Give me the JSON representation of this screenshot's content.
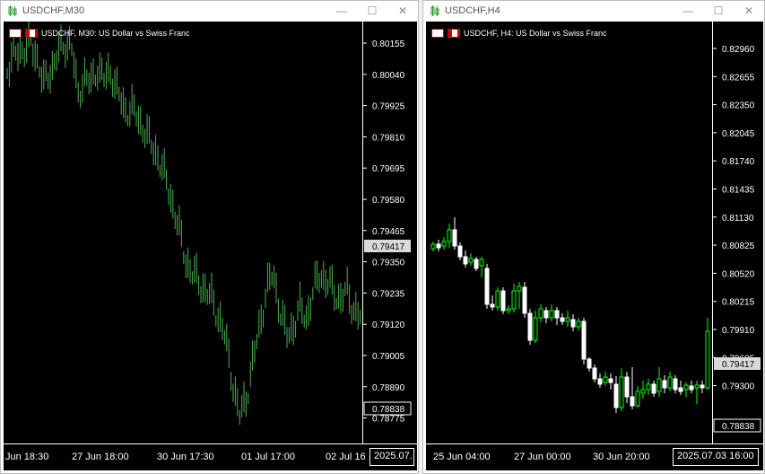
{
  "left": {
    "window_title": "USDCHF,M30",
    "chart_label": "USDCHF, M30:  US Dollar vs Swiss Franc",
    "prices": [
      "0.80155",
      "0.80040",
      "0.79925",
      "0.79810",
      "0.79695",
      "0.79580",
      "0.79465",
      "0.79350",
      "0.79235",
      "0.79120",
      "0.79005",
      "0.78890",
      "0.78775"
    ],
    "current_price": "0.79417",
    "ask_price": "0.78838",
    "times": [
      "Jun 18:30",
      "27 Jun 18:00",
      "30 Jun 17:30",
      "01 Jul 17:00",
      "02 Jul 16"
    ],
    "time_box": "2025.07."
  },
  "right": {
    "window_title": "USDCHF,H4",
    "chart_label": "USDCHF, H4:  US Dollar vs Swiss Franc",
    "prices": [
      "0.82960",
      "0.82655",
      "0.82350",
      "0.82045",
      "0.81740",
      "0.81435",
      "0.81130",
      "0.80825",
      "0.80520",
      "0.80215",
      "0.79910",
      "0.79605",
      "0.79300"
    ],
    "current_price": "0.79417",
    "ask_price": "0.78838",
    "times": [
      "25 Jun 04:00",
      "27 Jun 00:00",
      "30 Jun 20:00"
    ],
    "time_box": "2025.07.03 16:00"
  },
  "colors": {
    "bull": "#00ff00",
    "bear": "#ffffff",
    "bar": "#4caf50",
    "bg": "#000000"
  }
}
